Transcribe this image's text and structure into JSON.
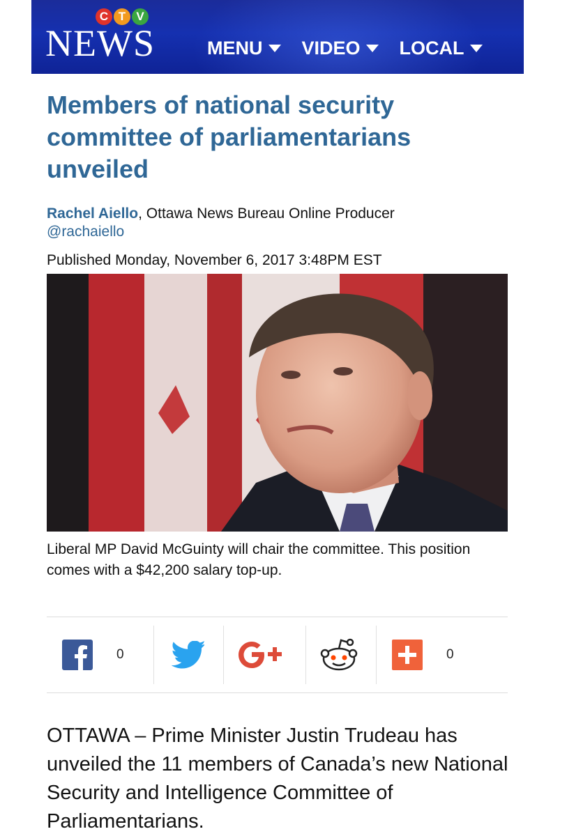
{
  "header": {
    "logo_ctv": [
      "C",
      "T",
      "V"
    ],
    "logo_news": "NEWS",
    "nav": [
      {
        "label": "MENU"
      },
      {
        "label": "VIDEO"
      },
      {
        "label": "LOCAL"
      }
    ],
    "colors": {
      "background": "#1530b0",
      "ctv_c": "#e0332a",
      "ctv_t": "#f29a1f",
      "ctv_v": "#3aa640"
    }
  },
  "article": {
    "headline": "Members of national security committee of parliamentarians unveiled",
    "author": "Rachel Aiello",
    "author_role": ", Ottawa News Bureau Online Producer",
    "twitter": "@rachaiello",
    "published": "Published Monday, November 6, 2017 3:48PM EST",
    "caption": "Liberal MP David McGuinty will chair the committee. This position comes with a $42,200 salary top-up.",
    "lead": "OTTAWA – Prime Minister Justin Trudeau has unveiled the 11 members of Canada’s new National Security and Intelligence Committee of Parliamentarians."
  },
  "share": {
    "facebook_count": "0",
    "plus_count": "0",
    "icons": [
      "facebook-icon",
      "twitter-icon",
      "google-plus-icon",
      "reddit-icon",
      "add-share-icon"
    ]
  }
}
